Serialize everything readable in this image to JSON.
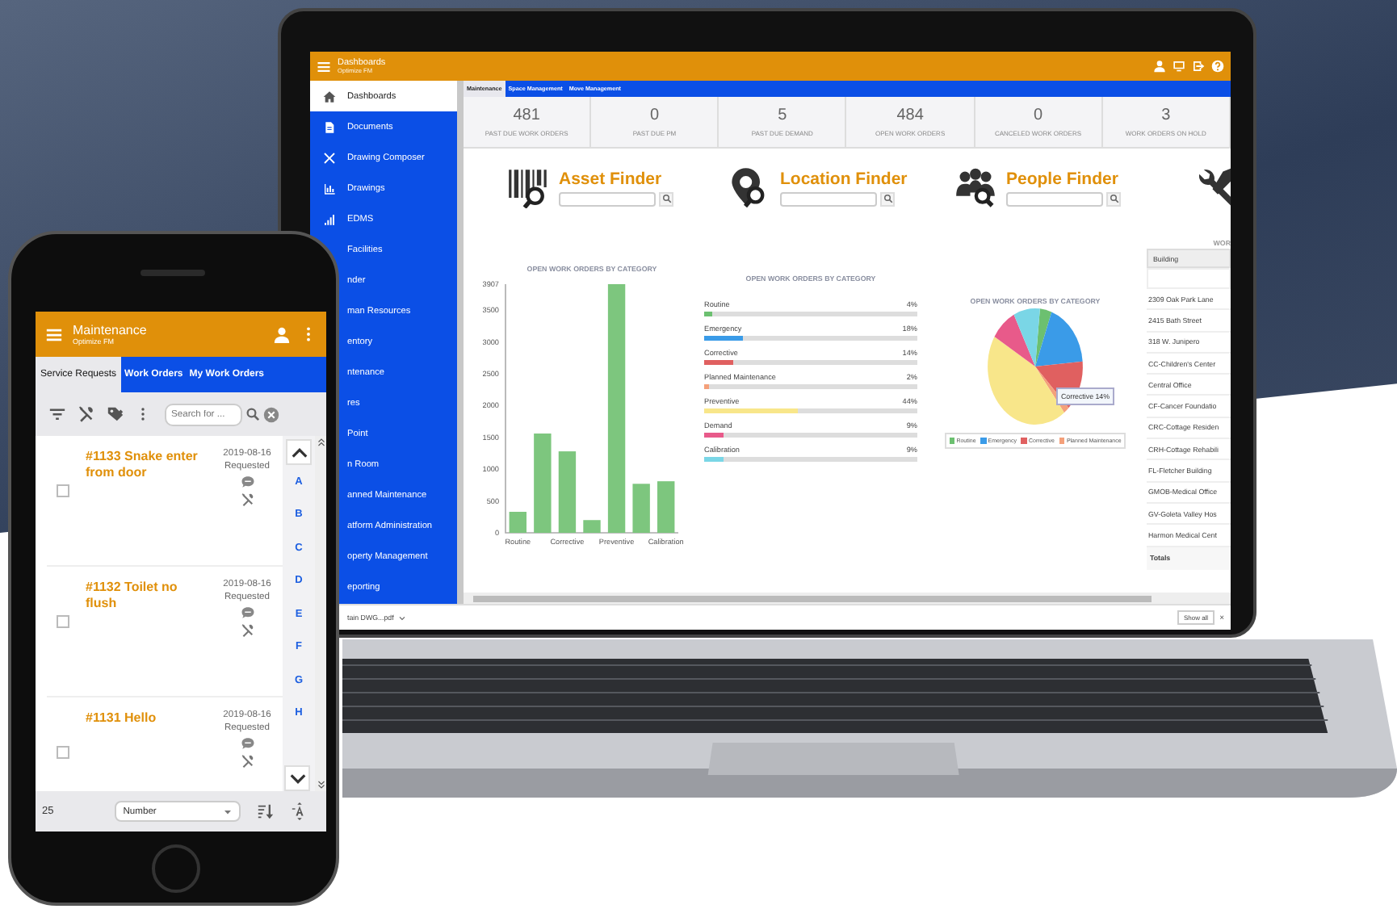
{
  "laptop": {
    "header": {
      "title": "Dashboards",
      "subtitle": "Optimize FM"
    },
    "sidebar": {
      "items": [
        {
          "label": "Dashboards",
          "selected": true
        },
        {
          "label": "Documents",
          "selected": false
        },
        {
          "label": "Drawing Composer",
          "selected": false
        },
        {
          "label": "Drawings",
          "selected": false
        },
        {
          "label": "EDMS",
          "selected": false
        },
        {
          "label": "Facilities",
          "selected": false
        },
        {
          "label": "nder",
          "selected": false
        },
        {
          "label": "man Resources",
          "selected": false
        },
        {
          "label": "entory",
          "selected": false
        },
        {
          "label": "ntenance",
          "selected": false
        },
        {
          "label": "res",
          "selected": false
        },
        {
          "label": "Point",
          "selected": false
        },
        {
          "label": "n Room",
          "selected": false
        },
        {
          "label": "anned Maintenance",
          "selected": false
        },
        {
          "label": "atform Administration",
          "selected": false
        },
        {
          "label": "operty Management",
          "selected": false
        },
        {
          "label": "eporting",
          "selected": false
        }
      ]
    },
    "tabs": [
      {
        "label": "Maintenance",
        "selected": true
      },
      {
        "label": "Space Management",
        "selected": false
      },
      {
        "label": "Move Management",
        "selected": false
      }
    ],
    "stats": [
      {
        "value": "481",
        "label": "PAST DUE WORK ORDERS"
      },
      {
        "value": "0",
        "label": "PAST DUE PM"
      },
      {
        "value": "5",
        "label": "PAST DUE DEMAND"
      },
      {
        "value": "484",
        "label": "OPEN WORK ORDERS"
      },
      {
        "value": "0",
        "label": "CANCELED WORK ORDERS"
      },
      {
        "value": "3",
        "label": "WORK ORDERS ON HOLD"
      }
    ],
    "finders": [
      {
        "kind": "asset",
        "label": "Asset Finder"
      },
      {
        "kind": "location",
        "label": "Location Finder"
      },
      {
        "kind": "people",
        "label": "People Finder"
      },
      {
        "kind": "tools"
      }
    ],
    "bar_chart": {
      "chart_data": {
        "type": "bar",
        "title": "OPEN WORK ORDERS BY CATEGORY",
        "categories": [
          "Routine",
          null,
          "Corrective",
          null,
          "Preventive",
          null,
          "Calibration"
        ],
        "series": [
          {
            "color": "#7dc67e",
            "values": [
              330,
              1560,
              1280,
              200,
              3907,
              770,
              810
            ]
          }
        ],
        "ylim": [
          0,
          3907
        ],
        "yticks": [
          0,
          500,
          1000,
          1500,
          2000,
          2500,
          3000,
          3500,
          3907
        ]
      }
    },
    "category_progress": {
      "title": "OPEN WORK ORDERS BY CATEGORY",
      "items": [
        {
          "label": "Routine",
          "reading": "4%",
          "level": 0.04,
          "color": "#6cc070"
        },
        {
          "label": "Emergency",
          "reading": "18%",
          "level": 0.18,
          "color": "#3a9be8"
        },
        {
          "label": "Corrective",
          "reading": "14%",
          "level": 0.14,
          "color": "#e06060"
        },
        {
          "label": "Planned Maintenance",
          "reading": "2%",
          "level": 0.02,
          "color": "#f4a07a"
        },
        {
          "label": "Preventive",
          "reading": "44%",
          "level": 0.44,
          "color": "#f8e68a"
        },
        {
          "label": "Demand",
          "reading": "9%",
          "level": 0.09,
          "color": "#e85a8a"
        },
        {
          "label": "Calibration",
          "reading": "9%",
          "level": 0.09,
          "color": "#7ad6e6"
        }
      ]
    },
    "pie_chart": {
      "title": "OPEN WORK ORDERS BY CATEGORY",
      "tooltip": "Corrective 14%",
      "legend": [
        {
          "label": "Routine",
          "color": "#6cc070"
        },
        {
          "label": "Emergency",
          "color": "#3a9be8"
        },
        {
          "label": "Corrective",
          "color": "#e06060"
        },
        {
          "label": "Planned Maintenance",
          "color": "#f4a07a"
        }
      ]
    },
    "table": {
      "title": "WOR",
      "columns": [
        "Building"
      ],
      "rows": [
        "2309 Oak Park Lane",
        "2415 Bath Street",
        "318 W. Junipero",
        "CC-Children's Center",
        "Central Office",
        "CF-Cancer Foundatio",
        "CRC-Cottage Residen",
        "CRH-Cottage Rehabili",
        "FL-Fletcher Building",
        "GMOB-Medical Office",
        "GV-Goleta Valley Hos",
        "Harmon Medical Cent"
      ],
      "totals_label": "Totals"
    },
    "download_bar": {
      "file": "tain DWG...pdf",
      "show_all": "Show all",
      "close": "×"
    }
  },
  "phone": {
    "header": {
      "title": "Maintenance",
      "subtitle": "Optimize FM"
    },
    "tabs": [
      {
        "label": "Service Requests",
        "selected": true
      },
      {
        "label": "Work Orders",
        "selected": false
      },
      {
        "label": "My Work Orders",
        "selected": false
      }
    ],
    "search": {
      "placeholder": "Search for ..."
    },
    "requests": [
      {
        "title": "#1133 Snake enter from door",
        "date": "2019-08-16",
        "status": "Requested",
        "checked": false
      },
      {
        "title": "#1132 Toilet no flush",
        "date": "2019-08-16",
        "status": "Requested",
        "checked": false
      },
      {
        "title": "#1131 Hello",
        "date": "2019-08-16",
        "status": "Requested",
        "checked": false
      }
    ],
    "index_letters": [
      "A",
      "B",
      "C",
      "D",
      "E",
      "F",
      "G",
      "H"
    ],
    "footer": {
      "page_size": "25",
      "sort_field": "Number"
    }
  }
}
